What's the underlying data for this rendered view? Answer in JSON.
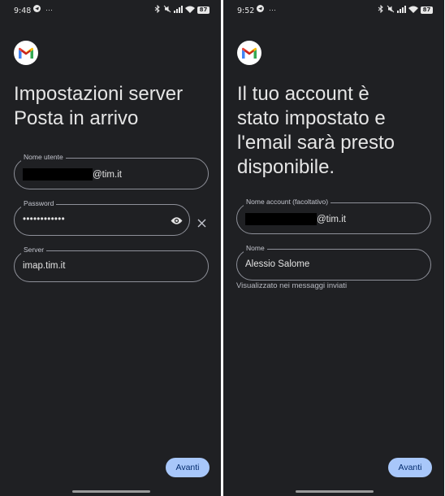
{
  "left": {
    "status": {
      "time": "9:48",
      "dots": "···",
      "battery": "87"
    },
    "title_line1": "Impostazioni server",
    "title_line2": "Posta in arrivo",
    "username": {
      "label": "Nome utente",
      "suffix": "@tim.it"
    },
    "password": {
      "label": "Password",
      "value": "••••••••••••"
    },
    "server": {
      "label": "Server",
      "value": "imap.tim.it"
    },
    "next_label": "Avanti"
  },
  "right": {
    "status": {
      "time": "9:52",
      "dots": "···",
      "battery": "87"
    },
    "title_line1": "Il tuo account è",
    "title_line2": "stato impostato e",
    "title_line3": "l'email sarà presto",
    "title_line4": "disponibile.",
    "account_name": {
      "label": "Nome account (facoltativo)",
      "suffix": "@tim.it"
    },
    "name": {
      "label": "Nome",
      "value": "Alessio Salome"
    },
    "helper": "Visualizzato nei messaggi inviati",
    "next_label": "Avanti"
  },
  "icons": [
    "telegram-icon",
    "bluetooth-icon",
    "mute-icon",
    "signal-icon",
    "wifi-icon",
    "battery-icon",
    "gmail-logo",
    "eye-icon",
    "close-icon"
  ],
  "colors": {
    "background": "#1f2023",
    "accent_button": "#a8c7fa",
    "button_text": "#062e6f",
    "outline": "#8e9099"
  }
}
